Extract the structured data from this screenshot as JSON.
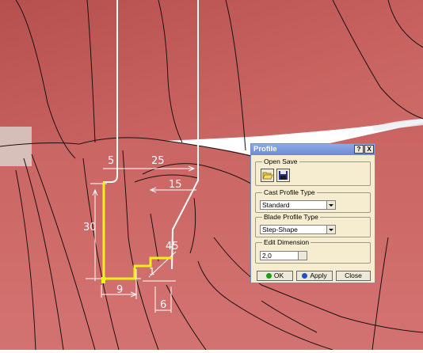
{
  "dimensions": {
    "d5": "5",
    "d25": "25",
    "d15": "15",
    "d30": "30",
    "d45": "45",
    "d9": "9",
    "d6": "6",
    "d1": "1"
  },
  "dialog": {
    "title": "Profile",
    "help_label": "?",
    "close_label": "X",
    "open_save": {
      "legend": "Open Save",
      "open_icon": "folder-open-icon",
      "save_icon": "floppy-save-icon"
    },
    "cast_profile": {
      "legend": "Cast Profile Type",
      "value": "Standard"
    },
    "blade_profile": {
      "legend": "Blade Profile Type",
      "value": "Step-Shape"
    },
    "edit_dimension": {
      "legend": "Edit Dimension",
      "value": "2,0"
    },
    "buttons": {
      "ok": "OK",
      "apply": "Apply",
      "close": "Close"
    }
  },
  "colors": {
    "surface": "#c8605e",
    "profile_line": "#f2ef1a",
    "dimension_line": "#ffffff",
    "ok_green": "#1a9c1a",
    "apply_blue": "#1a52c8"
  }
}
